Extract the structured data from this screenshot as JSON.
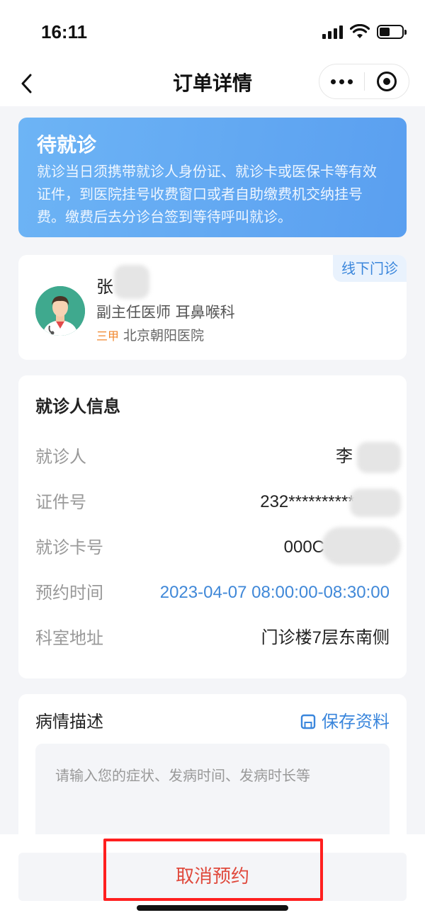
{
  "status_bar": {
    "time": "16:11"
  },
  "nav": {
    "title": "订单详情"
  },
  "banner": {
    "status": "待就诊",
    "description": "就诊当日须携带就诊人身份证、就诊卡或医保卡等有效证件，到医院挂号收费窗口或者自助缴费机交纳挂号费。缴费后去分诊台签到等待呼叫就诊。"
  },
  "doctor": {
    "visit_type": "线下门诊",
    "name": "张",
    "title": "副主任医师 耳鼻喉科",
    "hospital_grade": "三甲",
    "hospital": "北京朝阳医院"
  },
  "patient_info": {
    "heading": "就诊人信息",
    "rows": [
      {
        "label": "就诊人",
        "value": "李"
      },
      {
        "label": "证件号",
        "value": "232***********"
      },
      {
        "label": "就诊卡号",
        "value": "000C"
      },
      {
        "label": "预约时间",
        "value": "2023-04-07 08:00:00-08:30:00"
      },
      {
        "label": "科室地址",
        "value": "门诊楼7层东南侧"
      }
    ]
  },
  "description": {
    "title": "病情描述",
    "save_label": "保存资料",
    "placeholder": "请输入您的症状、发病时间、发病时长等"
  },
  "actions": {
    "cancel_label": "取消预约"
  },
  "colors": {
    "accent": "#3a86dc",
    "banner": "#5a9ff0",
    "cancel": "#e0493c",
    "highlight": "#ff1f1f",
    "grade": "#f0862c"
  },
  "icons": [
    "back-arrow-icon",
    "more-dots-icon",
    "close-target-icon",
    "save-icon",
    "doctor-avatar-icon"
  ]
}
